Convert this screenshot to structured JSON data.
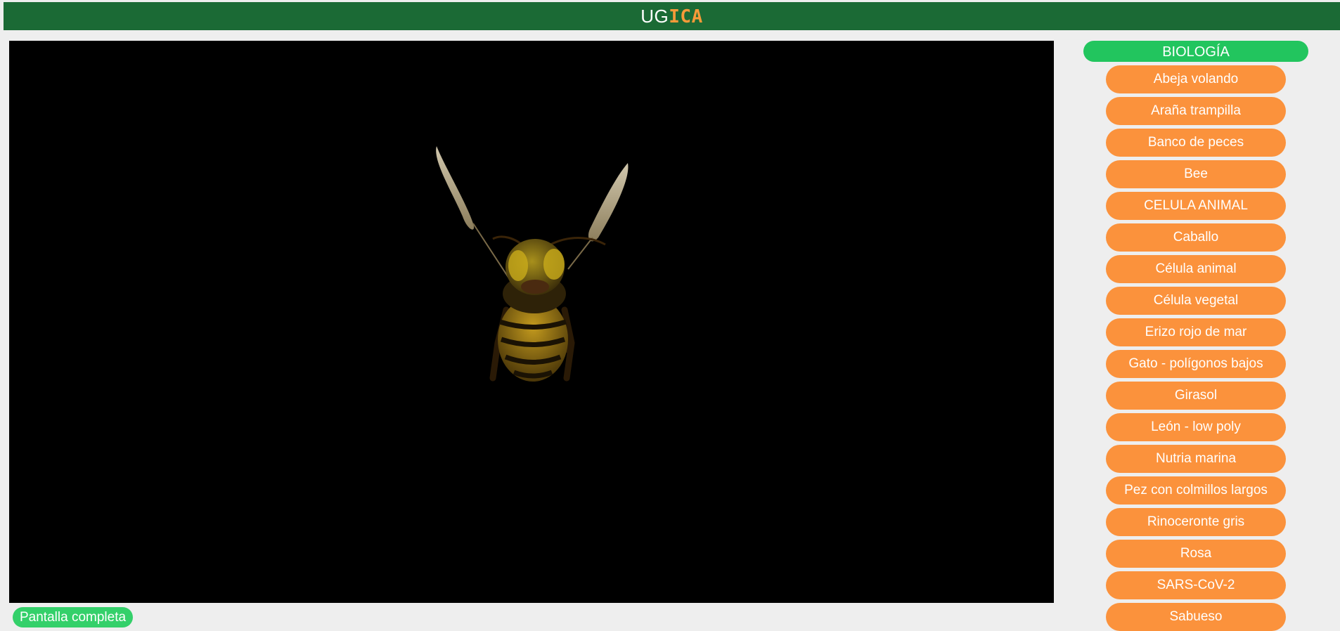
{
  "header": {
    "brand_part1": "UG",
    "brand_part2": "ICA",
    "colors": {
      "bar": "#1b6a35",
      "accent": "#f79a39"
    }
  },
  "viewer": {
    "model_shown": "bee-model",
    "background": "#000000"
  },
  "fullscreen_label": "Pantalla completa",
  "sidebar": {
    "category": "BIOLOGÍA",
    "items": [
      "Abeja volando",
      "Araña trampilla",
      "Banco de peces",
      "Bee",
      "CELULA ANIMAL",
      "Caballo",
      "Célula animal",
      "Célula vegetal",
      "Erizo rojo de mar",
      "Gato - polígonos bajos",
      "Girasol",
      "León - low poly",
      "Nutria marina",
      "Pez con colmillos largos",
      "Rinoceronte gris",
      "Rosa",
      "SARS-CoV-2",
      "Sabueso"
    ],
    "colors": {
      "category": "#22c55e",
      "item": "#fb923c"
    }
  }
}
